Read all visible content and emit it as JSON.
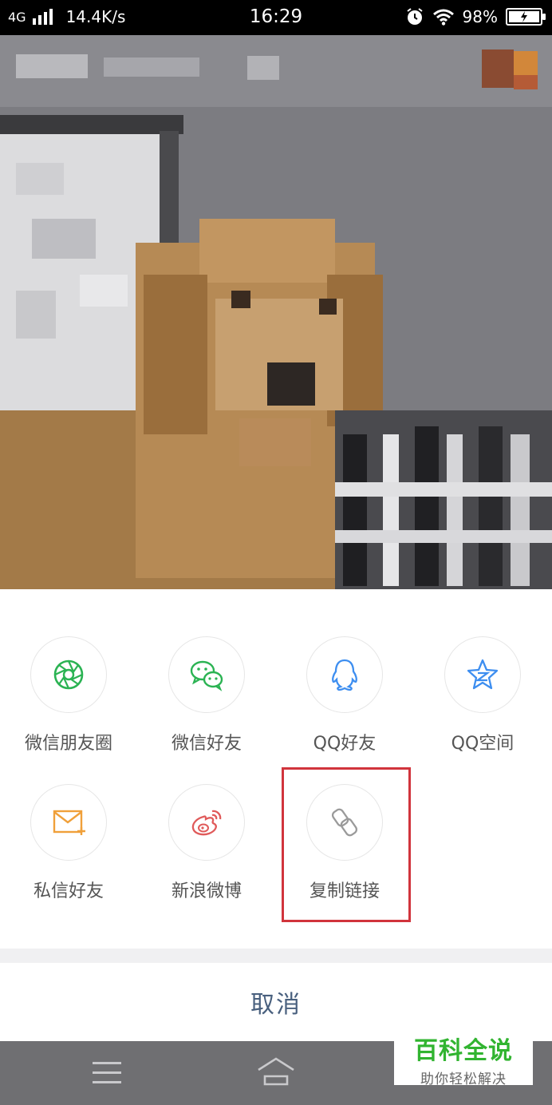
{
  "status_bar": {
    "network": "4G",
    "speed": "14.4K/s",
    "time": "16:29",
    "battery": "98%"
  },
  "share_options": [
    {
      "label": "微信朋友圈",
      "icon": "wechat-moments-icon",
      "color": "#2bb353"
    },
    {
      "label": "微信好友",
      "icon": "wechat-icon",
      "color": "#2bb353"
    },
    {
      "label": "QQ好友",
      "icon": "qq-icon",
      "color": "#3d8ef0"
    },
    {
      "label": "QQ空间",
      "icon": "qzone-icon",
      "color": "#3d8ef0"
    },
    {
      "label": "私信好友",
      "icon": "mail-icon",
      "color": "#f0a03a"
    },
    {
      "label": "新浪微博",
      "icon": "weibo-icon",
      "color": "#e05a5a"
    },
    {
      "label": "复制链接",
      "icon": "link-icon",
      "color": "#9a9a9a"
    }
  ],
  "cancel_label": "取消",
  "highlight_color": "#d1343c",
  "watermark": {
    "title": "百科全说",
    "subtitle": "助你轻松解决"
  }
}
